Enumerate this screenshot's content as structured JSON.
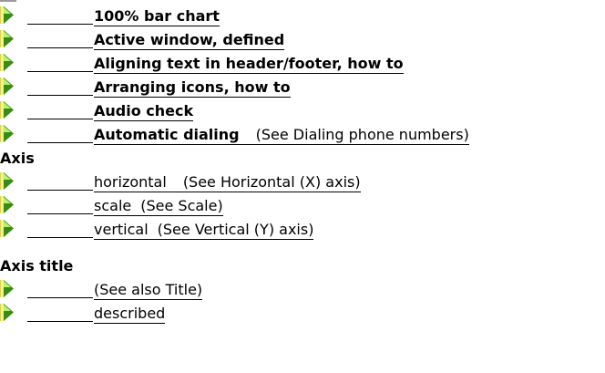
{
  "index_entries": [
    {
      "main": "100% bar chart",
      "see": "",
      "bold": true
    },
    {
      "main": "Active window, defined",
      "see": "",
      "bold": true
    },
    {
      "main": "Aligning text in header/footer, how to",
      "see": "",
      "bold": true
    },
    {
      "main": "Arranging icons, how to",
      "see": "",
      "bold": true
    },
    {
      "main": "Audio check",
      "see": "",
      "bold": true
    },
    {
      "main": "Automatic dialing",
      "see": "(See Dialing phone numbers)",
      "bold": true
    }
  ],
  "axis": {
    "heading": "Axis",
    "entries": [
      {
        "main": "horizontal",
        "see": "(See Horizontal (X) axis)"
      },
      {
        "main": "scale",
        "see": "(See Scale)"
      },
      {
        "main": "vertical",
        "see": "(See Vertical (Y) axis)"
      }
    ]
  },
  "axis_title": {
    "heading": "Axis title",
    "entries": [
      {
        "main": "(See also Title)",
        "see": ""
      },
      {
        "main": "described",
        "see": ""
      }
    ]
  },
  "colors": {
    "arrow_fill": "#3a8a1a",
    "arrow_light": "#b8f070",
    "arrow_bg": "#f3f38a",
    "text": "#000000"
  },
  "icon": "jump-arrow-icon"
}
